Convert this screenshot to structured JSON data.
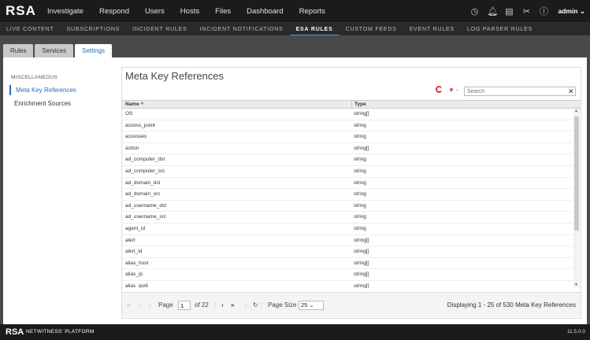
{
  "app": {
    "logo": "RSA",
    "footer_logo": "RSA",
    "footer_brand": "NETWITNESS' PLATFORM",
    "version": "11.5.0.0"
  },
  "topnav": {
    "items": [
      "Investigate",
      "Respond",
      "Users",
      "Hosts",
      "Files",
      "Dashboard",
      "Reports"
    ],
    "user": "admin ⌄"
  },
  "subnav": {
    "items": [
      "LIVE CONTENT",
      "SUBSCRIPTIONS",
      "INCIDENT RULES",
      "INCIDENT NOTIFICATIONS",
      "ESA RULES",
      "CUSTOM FEEDS",
      "EVENT RULES",
      "LOG PARSER RULES"
    ],
    "active": "ESA RULES"
  },
  "tabs": [
    "Rules",
    "Services",
    "Settings"
  ],
  "left_menu": {
    "heading": "MISCELLANEOUS",
    "items": [
      "Meta Key References",
      "Enrichment Sources"
    ]
  },
  "main": {
    "title": "Meta Key References",
    "search_placeholder": "Search",
    "columns": {
      "name": "Name ^",
      "type": "Type"
    },
    "rows": [
      [
        "OS",
        "string[]"
      ],
      [
        "access_point",
        "string"
      ],
      [
        "accesses",
        "string"
      ],
      [
        "action",
        "string[]"
      ],
      [
        "ad_computer_dst",
        "string"
      ],
      [
        "ad_computer_src",
        "string"
      ],
      [
        "ad_domain_dst",
        "string"
      ],
      [
        "ad_domain_src",
        "string"
      ],
      [
        "ad_username_dst",
        "string"
      ],
      [
        "ad_username_src",
        "string"
      ],
      [
        "agent_id",
        "string"
      ],
      [
        "alert",
        "string[]"
      ],
      [
        "alert_id",
        "string[]"
      ],
      [
        "alias_host",
        "string[]"
      ],
      [
        "alias_ip",
        "string[]"
      ],
      [
        "alias_ipv6",
        "string[]"
      ]
    ]
  },
  "pager": {
    "page_label": "Page",
    "page_value": "1",
    "of_label": "of 22",
    "size_label": "Page Size",
    "size_value": "25 ⌄",
    "display": "Displaying 1 - 25 of 530 Meta Key References"
  }
}
